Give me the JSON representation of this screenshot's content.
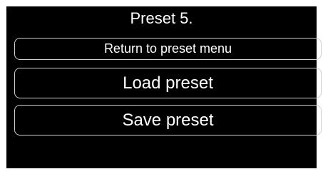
{
  "screen": {
    "title": "Preset 5.",
    "buttons": {
      "return_label": "Return to preset menu",
      "load_label": "Load preset",
      "save_label": "Save preset"
    }
  },
  "colors": {
    "background": "#000000",
    "text": "#ffffff",
    "button_border": "#cfcfcf"
  }
}
